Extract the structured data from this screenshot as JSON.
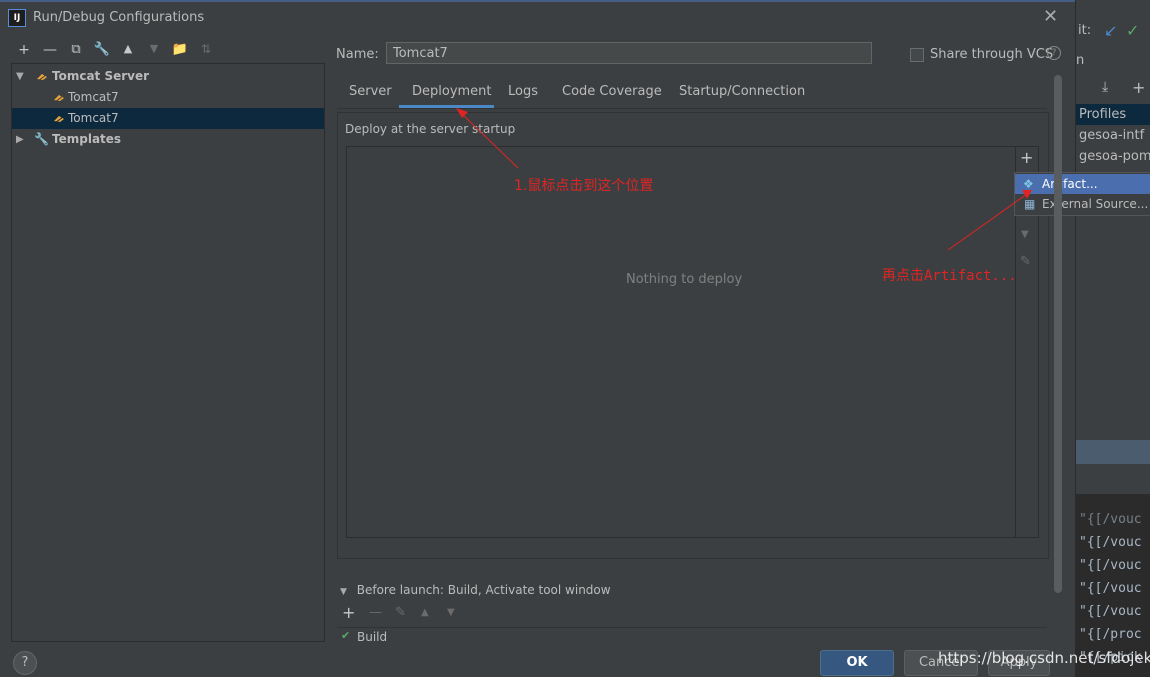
{
  "dialog": {
    "title": "Run/Debug Configurations",
    "app_icon": "IJ",
    "close_icon": "close-icon"
  },
  "toolbar": {
    "icons": [
      "add-icon",
      "remove-icon",
      "copy-icon",
      "wrench-icon",
      "move-up-icon",
      "move-down-icon",
      "folder-icon",
      "sort-icon"
    ]
  },
  "tree": {
    "group_label": "Tomcat Server",
    "items": [
      "Tomcat7",
      "Tomcat7"
    ],
    "templates_label": "Templates"
  },
  "name": {
    "label": "Name:",
    "value": "Tomcat7"
  },
  "vcs": {
    "label": "Share through VCS",
    "help": "?"
  },
  "tabs": [
    "Server",
    "Deployment",
    "Logs",
    "Code Coverage",
    "Startup/Connection"
  ],
  "deploy": {
    "heading": "Deploy at the server startup",
    "empty_text": "Nothing to deploy",
    "plus": "+"
  },
  "popup": {
    "items": [
      "Artifact...",
      "External Source..."
    ]
  },
  "annotations": {
    "first": "1.鼠标点击到这个位置",
    "second": "再点击Artifact..."
  },
  "before_launch": {
    "label": "Before launch: Build, Activate tool window",
    "partial_item": "Build"
  },
  "buttons": {
    "help": "?",
    "ok": "OK",
    "cancel": "Cancel",
    "apply": "Apply"
  },
  "watermark": "https://blog.csdn.net/sfdojek",
  "background_ide": {
    "toolbar_text": "it:",
    "header_text": "n",
    "list": [
      "Profiles",
      "gesoa-intf",
      "gesoa-pom"
    ],
    "code_lines": [
      "\"{[/vouc",
      "\"{[/vouc",
      "\"{[/vouc",
      "\"{[/vouc",
      "\"{[/proc",
      "\"{[/pick"
    ],
    "code_partial": "\"{[/vouc"
  },
  "colors": {
    "accent": "#4a88c7",
    "selection": "#0d293e",
    "ok_button": "#365880",
    "annotation": "#e02424",
    "popup_highlight": "#4b6eaf"
  }
}
